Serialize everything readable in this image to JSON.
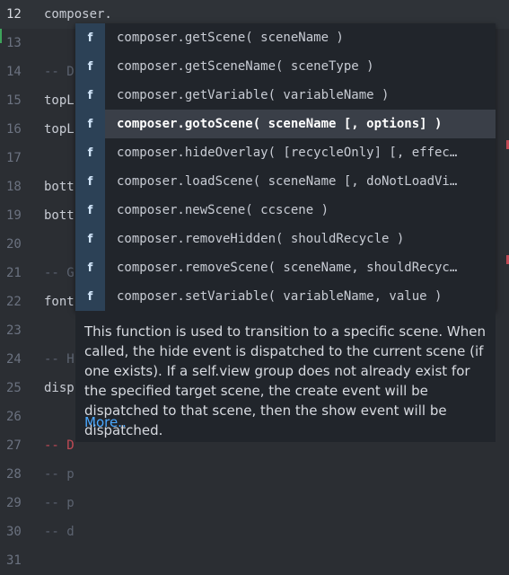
{
  "editor": {
    "lines": [
      {
        "number": "12",
        "text": "composer.",
        "kind": "code",
        "active": true
      },
      {
        "number": "13",
        "text": "",
        "kind": "code"
      },
      {
        "number": "14",
        "text": "-- D",
        "kind": "comment"
      },
      {
        "number": "15",
        "text": "topL",
        "kind": "code"
      },
      {
        "number": "16",
        "text": "topL",
        "kind": "code"
      },
      {
        "number": "17",
        "text": "",
        "kind": "code"
      },
      {
        "number": "18",
        "text": "bott",
        "kind": "code"
      },
      {
        "number": "19",
        "text": "bott",
        "kind": "code"
      },
      {
        "number": "20",
        "text": "",
        "kind": "code"
      },
      {
        "number": "21",
        "text": "-- G",
        "kind": "comment"
      },
      {
        "number": "22",
        "text": "font",
        "kind": "code"
      },
      {
        "number": "23",
        "text": "",
        "kind": "code"
      },
      {
        "number": "24",
        "text": "-- H",
        "kind": "comment"
      },
      {
        "number": "25",
        "text": "disp",
        "kind": "code"
      },
      {
        "number": "26",
        "text": "",
        "kind": "code"
      },
      {
        "number": "27",
        "text": "-- D",
        "kind": "comment-red"
      },
      {
        "number": "28",
        "text": "-- p",
        "kind": "comment"
      },
      {
        "number": "29",
        "text": "-- p",
        "kind": "comment"
      },
      {
        "number": "30",
        "text": "-- d",
        "kind": "comment"
      },
      {
        "number": "31",
        "text": "",
        "kind": "code"
      }
    ]
  },
  "autocomplete": {
    "icon": "function-icon",
    "icon_glyph": "f",
    "items": [
      {
        "label": "composer.getScene( sceneName )"
      },
      {
        "label": "composer.getSceneName( sceneType )"
      },
      {
        "label": "composer.getVariable( variableName )"
      },
      {
        "label": "composer.gotoScene( sceneName [, options] )",
        "selected": true
      },
      {
        "label": "composer.hideOverlay( [recycleOnly] [, effec…"
      },
      {
        "label": "composer.loadScene( sceneName [, doNotLoadVi…"
      },
      {
        "label": "composer.newScene( ccscene )"
      },
      {
        "label": "composer.removeHidden( shouldRecycle )"
      },
      {
        "label": "composer.removeScene( sceneName, shouldRecyc…"
      },
      {
        "label": "composer.setVariable( variableName, value )"
      }
    ]
  },
  "doc": {
    "text": "This function is used to transition to a specific scene. When called, the hide event is dispatched to the current scene (if one exists). If a self.view group does not already exist for the specified target scene, the create event will be dispatched to that scene, then the show event will be dispatched.",
    "more_label": "More.."
  },
  "colors": {
    "background": "#2b2e33",
    "popup": "#21252b",
    "selected": "#3a3f48",
    "icon_cell": "#2c4156",
    "link": "#4aa8ff",
    "red_comment": "#c04a55"
  }
}
